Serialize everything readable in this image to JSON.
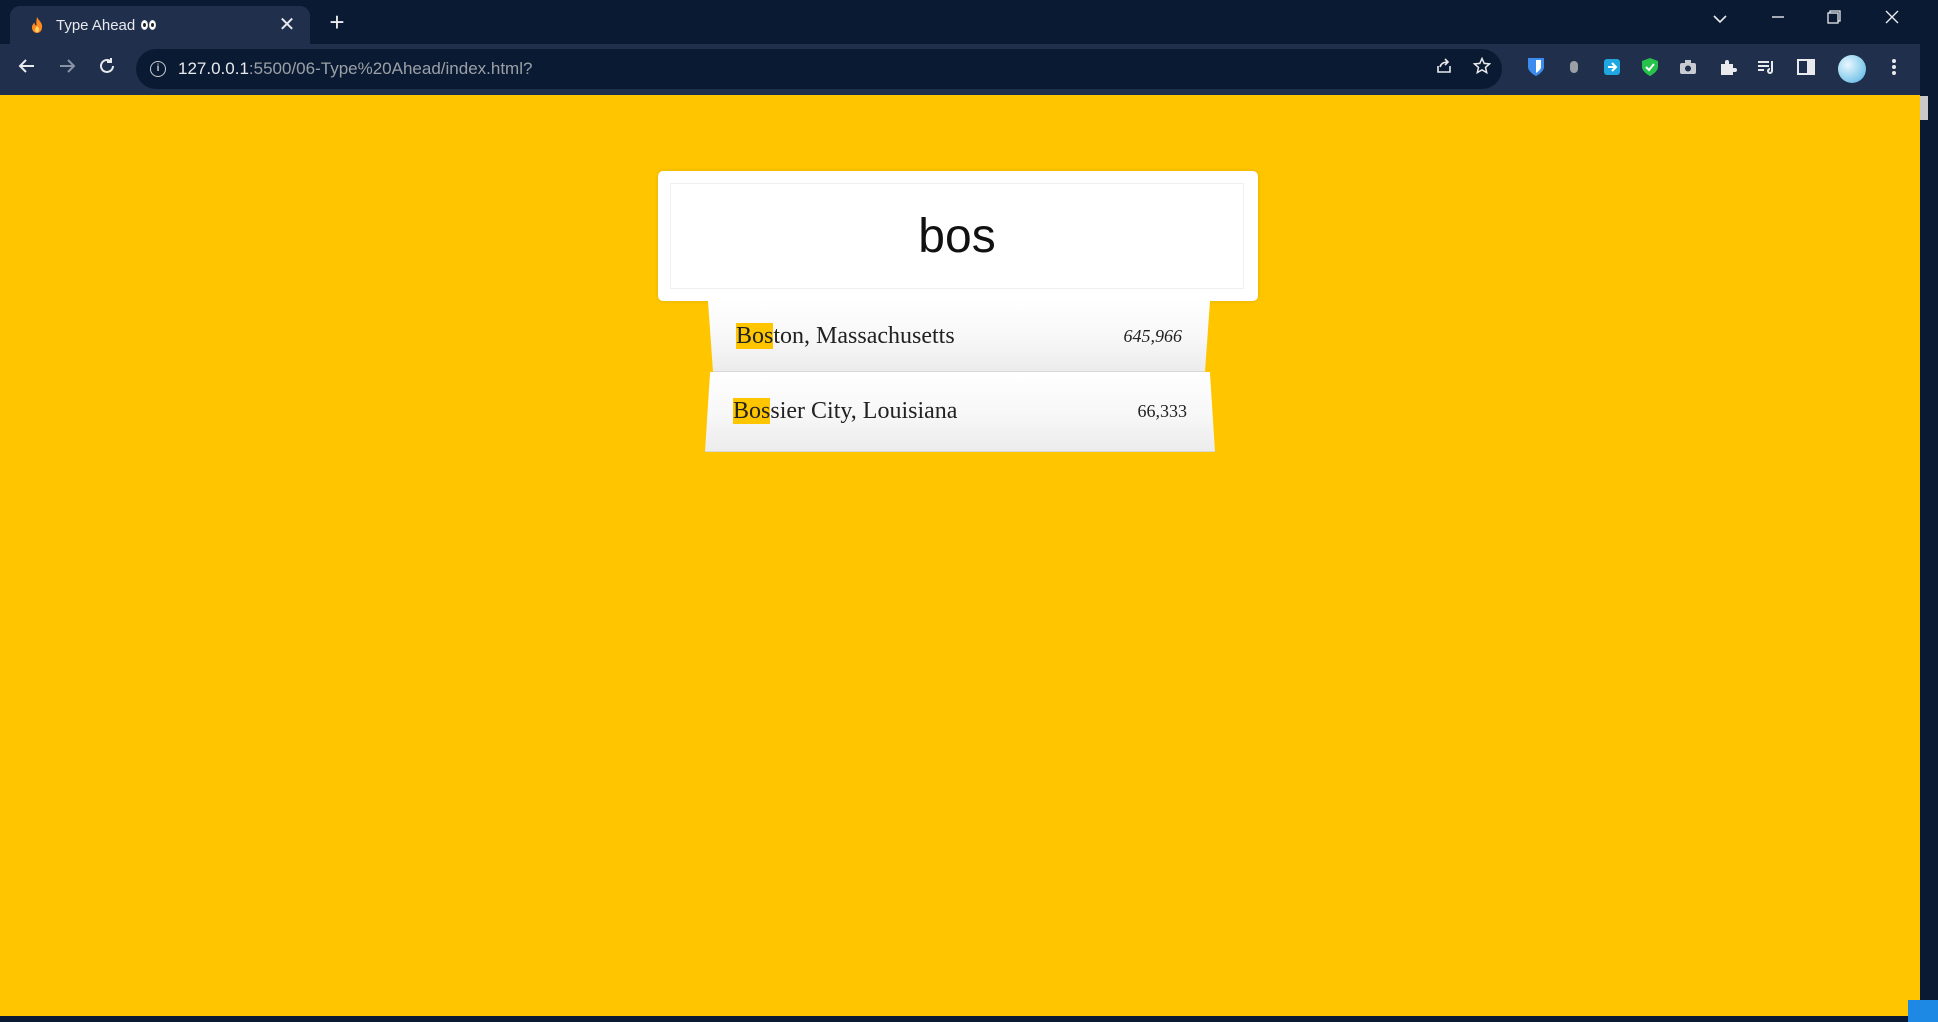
{
  "browser": {
    "tab_title": "Type Ahead",
    "url_host": "127.0.0.1",
    "url_path": ":5500/06-Type%20Ahead/index.html?",
    "new_tab": "+",
    "close_tab": "✕",
    "icons": [
      "fire-favicon",
      "eyes-emoji",
      "back-arrow-icon",
      "forward-arrow-icon",
      "reload-icon",
      "info-icon",
      "share-icon",
      "star-icon",
      "bitwarden-icon",
      "extension-icons",
      "puzzle-icon",
      "media-icon",
      "sidebar-icon",
      "profile-avatar",
      "menu-icon"
    ]
  },
  "search": {
    "query": "bos"
  },
  "suggestions": [
    {
      "highlight": "Bos",
      "rest": "ton, Massachusetts",
      "population": "645,966"
    },
    {
      "highlight": "Bos",
      "rest": "sier City, Louisiana",
      "population": "66,333"
    }
  ],
  "colors": {
    "background": "#ffc600",
    "highlight": "#ffc600",
    "chrome_dark": "#0b1a33",
    "chrome_toolbar": "#1f2f4c"
  }
}
